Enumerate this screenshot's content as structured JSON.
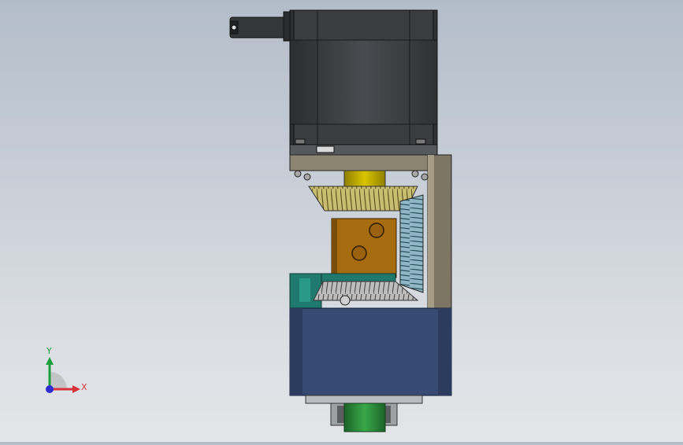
{
  "viewport": {
    "background_top": "#b3bdc9",
    "background_bottom": "#e3e5e8"
  },
  "model": {
    "parts": [
      {
        "name": "stepper-motor",
        "color": "#3e4144"
      },
      {
        "name": "motor-connector",
        "color": "#2e3033"
      },
      {
        "name": "mounting-bracket",
        "color": "#7d7664"
      },
      {
        "name": "yellow-shaft",
        "color": "#c7b200"
      },
      {
        "name": "top-bevel-gear",
        "color": "#b4a860"
      },
      {
        "name": "side-bevel-gear",
        "color": "#6c94a3"
      },
      {
        "name": "center-block",
        "color": "#a76b10"
      },
      {
        "name": "bottom-bevel-gear",
        "color": "#8d8d8d"
      },
      {
        "name": "green-mount",
        "color": "#1f7a6d"
      },
      {
        "name": "blue-housing",
        "color": "#364a73"
      },
      {
        "name": "output-shaft",
        "color": "#2e8f3c"
      }
    ]
  },
  "triad": {
    "x_label": "X",
    "y_label": "Y",
    "x_color": "#d8323c",
    "y_color": "#1e9e3c",
    "z_color": "#2e2ed0"
  }
}
